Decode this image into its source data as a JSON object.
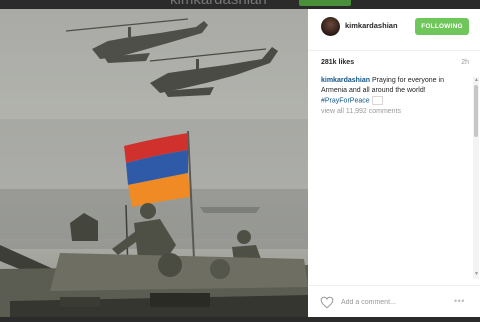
{
  "background_header": {
    "username_ghost": "kimkardashian"
  },
  "post": {
    "image_alt": "",
    "header": {
      "username": "kimkardashian",
      "follow_label": "FOLLOWING"
    },
    "likes": "281k likes",
    "time": "2h",
    "caption": {
      "username": "kimkardashian",
      "text": " Praying for everyone in Armenia and all around the world!",
      "hashtag": "#PrayForPeace"
    },
    "view_all_comments": "view all 11,992 comments",
    "comment_placeholder": "Add a comment...",
    "more_label": "•••"
  },
  "colors": {
    "follow_button": "#6fc65a",
    "link": "#125688",
    "flag_red": "#d0312d",
    "flag_blue": "#2f5aa8",
    "flag_orange": "#f08a24"
  },
  "icons": {
    "like": "heart-outline-icon",
    "options": "more-options-icon",
    "scroll_up": "triangle-up",
    "scroll_down": "triangle-down"
  }
}
